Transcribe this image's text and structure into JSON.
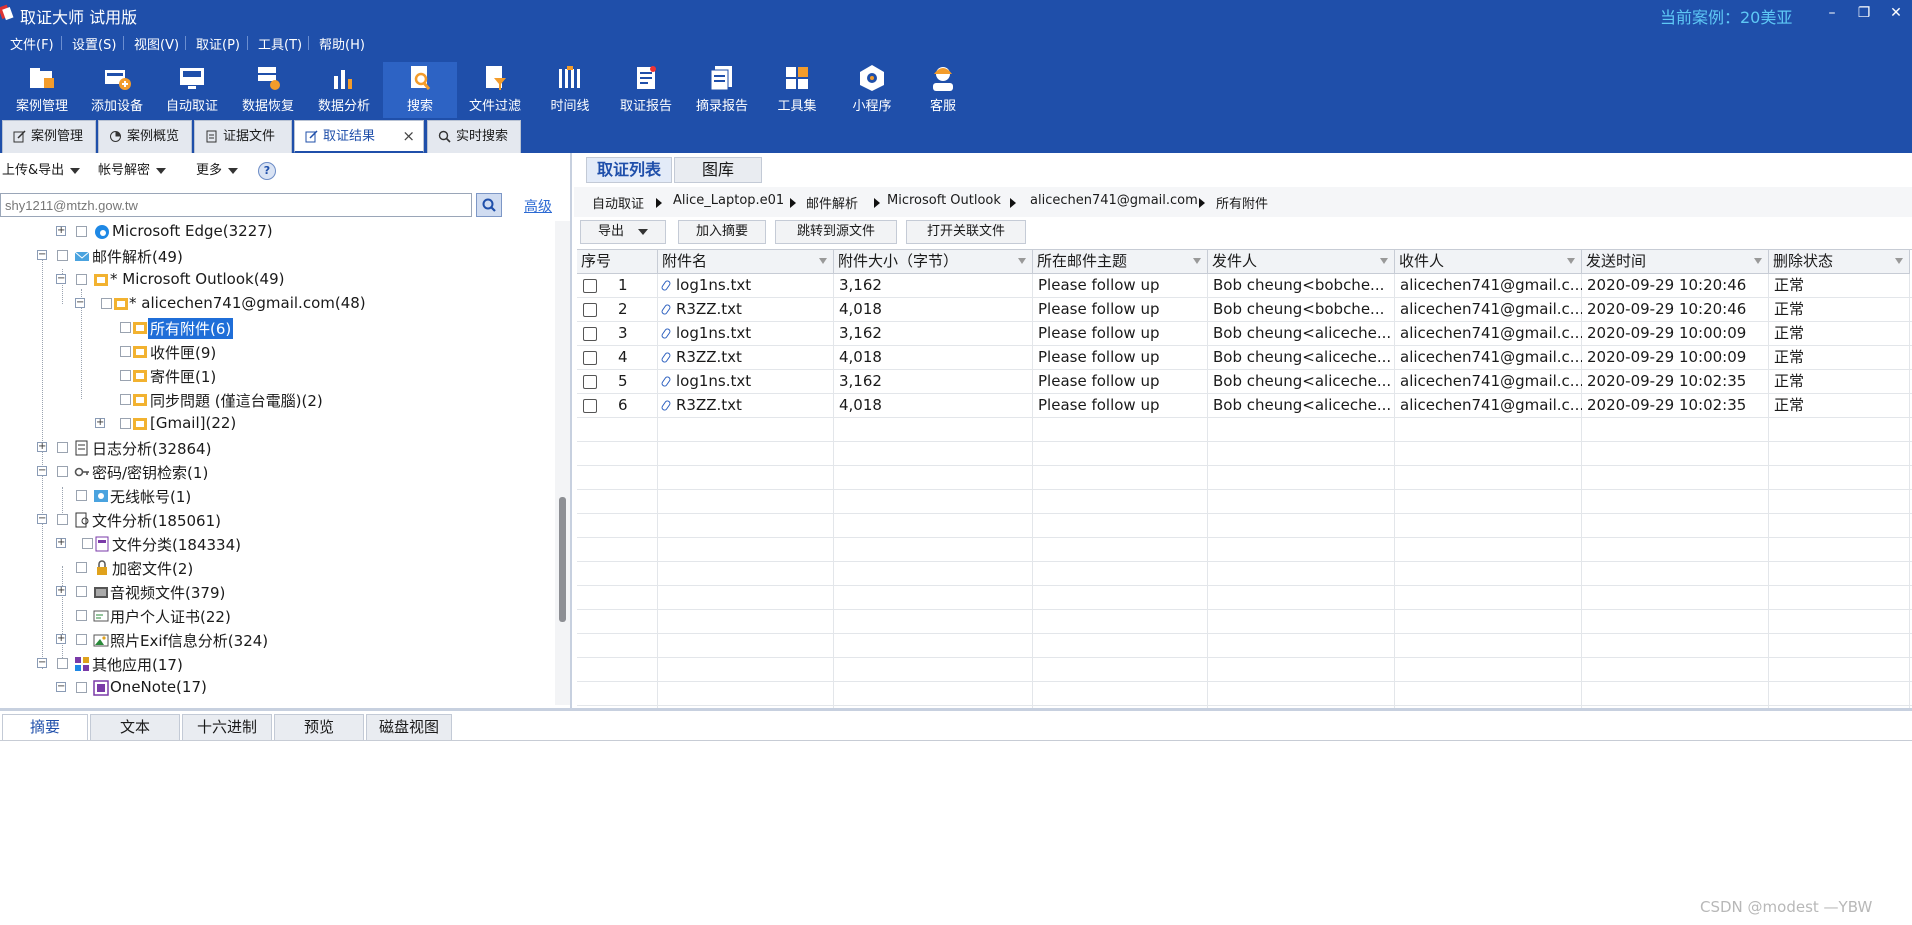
{
  "window": {
    "title": "取证大师 试用版",
    "current_case": "当前案例：20美亚",
    "controls": {
      "minimize": "–",
      "restore": "❐",
      "close": "✕"
    }
  },
  "menu": [
    "文件(F)",
    "设置(S)",
    "视图(V)",
    "取证(P)",
    "工具(T)",
    "帮助(H)"
  ],
  "toolbar": [
    {
      "label": "案例管理",
      "icon": "case-management-icon"
    },
    {
      "label": "添加设备",
      "icon": "add-device-icon"
    },
    {
      "label": "自动取证",
      "icon": "auto-forensics-icon"
    },
    {
      "label": "数据恢复",
      "icon": "data-recovery-icon"
    },
    {
      "label": "数据分析",
      "icon": "data-analysis-icon"
    },
    {
      "label": "搜索",
      "icon": "search-icon",
      "active": true
    },
    {
      "label": "文件过滤",
      "icon": "file-filter-icon"
    },
    {
      "label": "时间线",
      "icon": "timeline-icon"
    },
    {
      "label": "取证报告",
      "icon": "forensic-report-icon"
    },
    {
      "label": "摘录报告",
      "icon": "excerpt-report-icon"
    },
    {
      "label": "工具集",
      "icon": "toolkit-icon"
    },
    {
      "label": "小程序",
      "icon": "mini-program-icon"
    },
    {
      "label": "客服",
      "icon": "customer-service-icon"
    }
  ],
  "tabs": [
    {
      "label": "案例管理"
    },
    {
      "label": "案例概览"
    },
    {
      "label": "证据文件"
    },
    {
      "label": "取证结果",
      "active": true,
      "close": "×"
    },
    {
      "label": "实时搜索"
    }
  ],
  "left_panel": {
    "dropdowns": [
      "上传&导出",
      "帐号解密",
      "更多"
    ],
    "help": "?",
    "search_value": "shy1211@mtzh.gow.tw",
    "advanced_link": "高级",
    "tree": [
      {
        "label": "Microsoft Edge(3227)",
        "expander": "+"
      },
      {
        "label": "邮件解析(49)",
        "expander": "−"
      },
      {
        "label": "* Microsoft Outlook(49)",
        "expander": "−"
      },
      {
        "label": "* alicechen741@gmail.com(48)",
        "expander": "−"
      },
      {
        "label": "所有附件(6)",
        "selected": true
      },
      {
        "label": "收件匣(9)"
      },
      {
        "label": "寄件匣(1)"
      },
      {
        "label": "同步問題 (僅這台電腦)(2)"
      },
      {
        "label": "[Gmail](22)",
        "expander": "+"
      },
      {
        "label": "日志分析(32864)",
        "expander": "+"
      },
      {
        "label": "密码/密钥检索(1)",
        "expander": "−"
      },
      {
        "label": "无线帐号(1)"
      },
      {
        "label": "文件分析(185061)",
        "expander": "−"
      },
      {
        "label": "文件分类(184334)",
        "expander": "+"
      },
      {
        "label": "加密文件(2)"
      },
      {
        "label": "音视频文件(379)",
        "expander": "+"
      },
      {
        "label": "用户个人证书(22)"
      },
      {
        "label": "照片Exif信息分析(324)",
        "expander": "+"
      },
      {
        "label": "其他应用(17)",
        "expander": "−"
      },
      {
        "label": "OneNote(17)",
        "expander": "−"
      }
    ]
  },
  "right_panel": {
    "tabs": [
      {
        "label": "取证列表",
        "active": true
      },
      {
        "label": "图库"
      }
    ],
    "breadcrumb": [
      "自动取证",
      "Alice_Laptop.e01",
      "邮件解析",
      "Microsoft Outlook",
      "alicechen741@gmail.com",
      "所有附件"
    ],
    "actions": {
      "export": "导出",
      "add_excerpt": "加入摘要",
      "jump_to_source": "跳转到源文件",
      "open_related": "打开关联文件"
    },
    "columns": [
      "序号",
      "附件名",
      "附件大小（字节）",
      "所在邮件主题",
      "发件人",
      "收件人",
      "发送时间",
      "删除状态"
    ],
    "rows": [
      {
        "no": "1",
        "name": "log1ns.txt",
        "size": "3,162",
        "subject": "Please follow up",
        "sender": "Bob cheung<bobche...",
        "recipient": "alicechen741@gmail.c...",
        "time": "2020-09-29 10:20:46",
        "status": "正常"
      },
      {
        "no": "2",
        "name": "R3ZZ.txt",
        "size": "4,018",
        "subject": "Please follow up",
        "sender": "Bob cheung<bobche...",
        "recipient": "alicechen741@gmail.c...",
        "time": "2020-09-29 10:20:46",
        "status": "正常"
      },
      {
        "no": "3",
        "name": "log1ns.txt",
        "size": "3,162",
        "subject": "Please follow up",
        "sender": "Bob cheung<aliceche...",
        "recipient": "alicechen741@gmail.c...",
        "time": "2020-09-29 10:00:09",
        "status": "正常"
      },
      {
        "no": "4",
        "name": "R3ZZ.txt",
        "size": "4,018",
        "subject": "Please follow up",
        "sender": "Bob cheung<aliceche...",
        "recipient": "alicechen741@gmail.c...",
        "time": "2020-09-29 10:00:09",
        "status": "正常"
      },
      {
        "no": "5",
        "name": "log1ns.txt",
        "size": "3,162",
        "subject": "Please follow up",
        "sender": "Bob cheung<aliceche...",
        "recipient": "alicechen741@gmail.c...",
        "time": "2020-09-29 10:02:35",
        "status": "正常"
      },
      {
        "no": "6",
        "name": "R3ZZ.txt",
        "size": "4,018",
        "subject": "Please follow up",
        "sender": "Bob cheung<aliceche...",
        "recipient": "alicechen741@gmail.c...",
        "time": "2020-09-29 10:02:35",
        "status": "正常"
      }
    ]
  },
  "bottom_tabs": [
    {
      "label": "摘要",
      "active": true
    },
    {
      "label": "文本"
    },
    {
      "label": "十六进制"
    },
    {
      "label": "预览"
    },
    {
      "label": "磁盘视图"
    }
  ],
  "watermark": "CSDN @modest —YBW",
  "colors": {
    "brand": "#1f4faa",
    "accent": "#1f6ed8",
    "case_highlight": "#5ec8f5"
  }
}
